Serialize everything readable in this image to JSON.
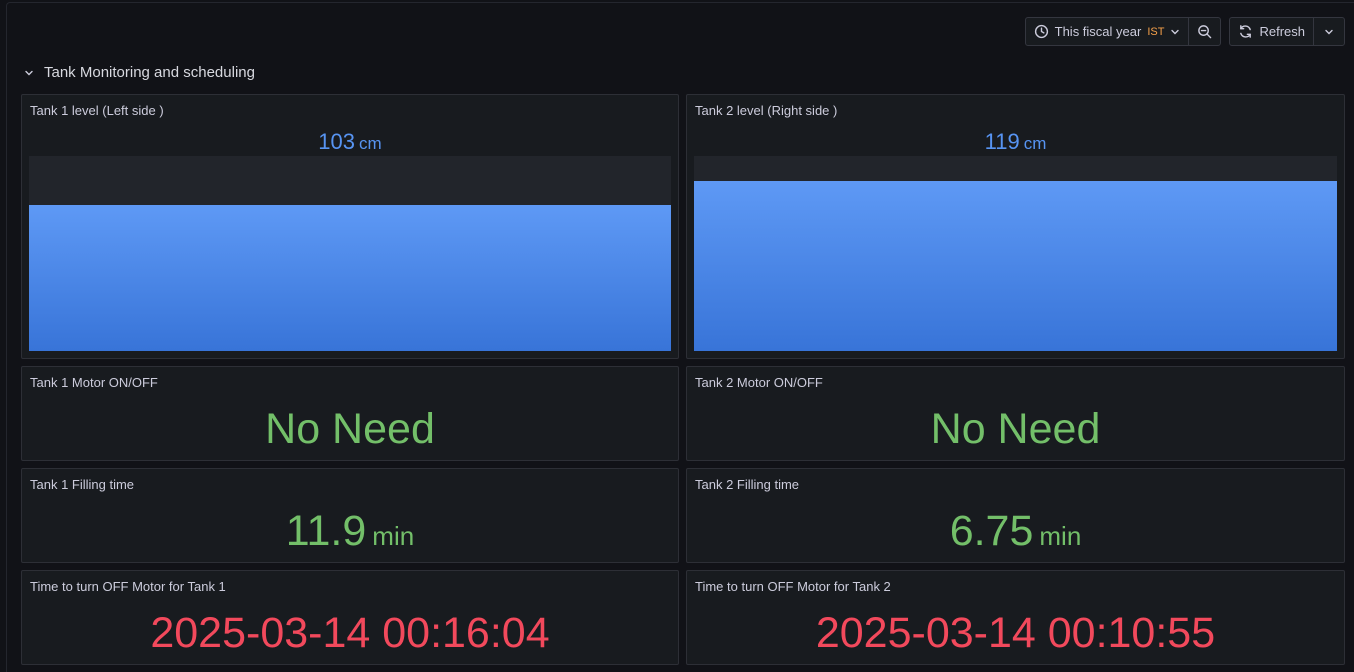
{
  "toolbar": {
    "time_range_label": "This fiscal year",
    "timezone": "IST",
    "refresh_label": "Refresh"
  },
  "row": {
    "title": "Tank Monitoring and scheduling"
  },
  "panels": {
    "tank1_level": {
      "title": "Tank 1 level (Left side )",
      "value": "103",
      "unit": "cm",
      "fill_fraction": 0.75
    },
    "tank2_level": {
      "title": "Tank 2 level (Right side )",
      "value": "119",
      "unit": "cm",
      "fill_fraction": 0.87
    },
    "tank1_motor": {
      "title": "Tank 1 Motor ON/OFF",
      "value": "No Need"
    },
    "tank2_motor": {
      "title": "Tank 2 Motor ON/OFF",
      "value": "No Need"
    },
    "tank1_filling": {
      "title": "Tank 1 Filling time",
      "value": "11.9",
      "unit": "min"
    },
    "tank2_filling": {
      "title": "Tank 2 Filling time",
      "value": "6.75",
      "unit": "min"
    },
    "tank1_off": {
      "title": "Time to turn OFF Motor for Tank 1",
      "value": "2025-03-14 00:16:04"
    },
    "tank2_off": {
      "title": "Time to turn OFF Motor for Tank 2",
      "value": "2025-03-14 00:10:55"
    }
  },
  "colors": {
    "gauge": "#5794f2",
    "ok": "#73bf69",
    "alert": "#f2495c",
    "timezone": "#f5a04a"
  },
  "icons": [
    "clock-icon",
    "chevron-down-icon",
    "zoom-out-icon",
    "refresh-icon"
  ]
}
